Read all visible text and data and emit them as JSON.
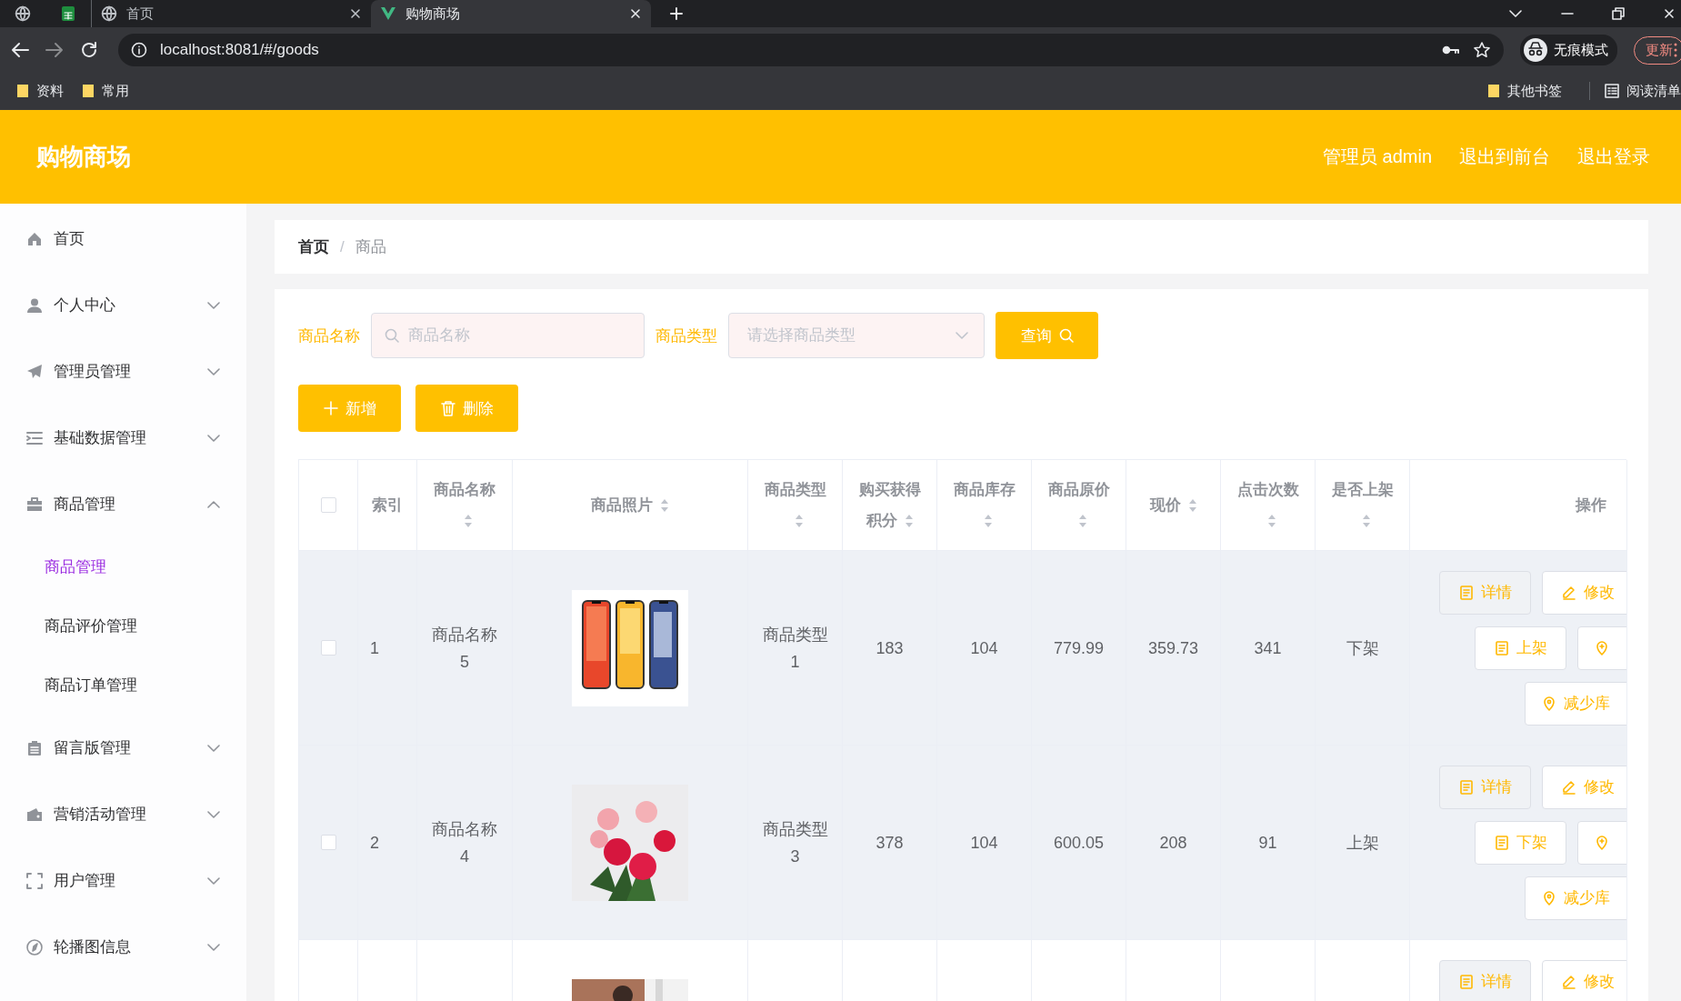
{
  "browser": {
    "tabs": [
      {
        "kind": "pinned-globe",
        "selected": false
      },
      {
        "kind": "pinned-sheet",
        "selected": false
      },
      {
        "kind": "page",
        "label": "首页",
        "selected": false
      },
      {
        "kind": "page",
        "label": "购物商场",
        "selected": true
      }
    ],
    "url": "localhost:8081/#/goods",
    "profile": "无痕模式",
    "update_button": "更新",
    "bookmarks": [
      {
        "label": "资料"
      },
      {
        "label": "常用"
      }
    ],
    "bookmarks_right": [
      {
        "kind": "folder",
        "label": "其他书签"
      },
      {
        "kind": "reading-list",
        "label": "阅读清单"
      }
    ]
  },
  "header": {
    "title": "购物商场",
    "links": [
      "管理员 admin",
      "退出到前台",
      "退出登录"
    ]
  },
  "sidebar": {
    "items": [
      {
        "label": "首页"
      },
      {
        "label": "个人中心",
        "expanded": false
      },
      {
        "label": "管理员管理",
        "expanded": false
      },
      {
        "label": "基础数据管理",
        "expanded": false
      },
      {
        "label": "商品管理",
        "expanded": true,
        "children": [
          {
            "label": "商品管理",
            "selected": true
          },
          {
            "label": "商品评价管理",
            "selected": false
          },
          {
            "label": "商品订单管理",
            "selected": false
          }
        ]
      },
      {
        "label": "留言版管理",
        "expanded": false
      },
      {
        "label": "营销活动管理",
        "expanded": false
      },
      {
        "label": "用户管理",
        "expanded": false
      },
      {
        "label": "轮播图信息",
        "expanded": false
      }
    ]
  },
  "breadcrumb": {
    "items": [
      "首页",
      "商品"
    ],
    "separator": "/"
  },
  "filters": [
    {
      "kind": "text",
      "label": "商品名称",
      "placeholder": "商品名称"
    },
    {
      "kind": "select",
      "label": "商品类型",
      "placeholder": "请选择商品类型"
    }
  ],
  "search_button": "查询",
  "actions": [
    {
      "kind": "add",
      "label": "新增"
    },
    {
      "kind": "delete",
      "label": "删除"
    }
  ],
  "table": {
    "select_all": {
      "checked": false
    },
    "columns": [
      {
        "kind": "check"
      },
      {
        "kind": "text",
        "label": "索引",
        "sortable": false
      },
      {
        "kind": "text",
        "label": "商品名称",
        "sortable": true
      },
      {
        "kind": "text",
        "label": "商品照片",
        "sortable": true
      },
      {
        "kind": "text",
        "label": "商品类型",
        "sortable": true
      },
      {
        "kind": "text",
        "label": "购买获得积分",
        "sortable": true
      },
      {
        "kind": "text",
        "label": "商品库存",
        "sortable": true
      },
      {
        "kind": "text",
        "label": "商品原价",
        "sortable": true
      },
      {
        "kind": "text",
        "label": "现价",
        "sortable": true
      },
      {
        "kind": "text",
        "label": "点击次数",
        "sortable": true
      },
      {
        "kind": "text",
        "label": "是否上架",
        "sortable": true
      },
      {
        "kind": "ops",
        "label": "操作",
        "sortable": false
      }
    ],
    "rows": [
      {
        "highlighted": true,
        "checked": false,
        "index": "1",
        "name": "商品名称5",
        "photo": {
          "kind": "picture"
        },
        "type": "商品类型1",
        "points": "183",
        "stock": "104",
        "original_price": "779.99",
        "price": "359.73",
        "clicks": "341",
        "status": "下架",
        "actions": [
          {
            "kind": "detail",
            "label": "详情"
          },
          {
            "kind": "edit",
            "label": "修改"
          },
          {
            "kind": "toggle",
            "label": "上架"
          },
          {
            "kind": "add-stock"
          },
          {
            "kind": "reduce-stock",
            "label": "减少库"
          }
        ]
      },
      {
        "highlighted": true,
        "checked": false,
        "index": "2",
        "name": "商品名称4",
        "photo": {
          "kind": "picture"
        },
        "type": "商品类型3",
        "points": "378",
        "stock": "104",
        "original_price": "600.05",
        "price": "208",
        "clicks": "91",
        "status": "上架",
        "actions": [
          {
            "kind": "detail",
            "label": "详情"
          },
          {
            "kind": "edit",
            "label": "修改"
          },
          {
            "kind": "toggle",
            "label": "下架"
          },
          {
            "kind": "add-stock"
          },
          {
            "kind": "reduce-stock",
            "label": "减少库"
          }
        ]
      },
      {
        "highlighted": false,
        "photo": {
          "kind": "picture"
        },
        "actions": [
          {
            "kind": "detail",
            "label": "详情"
          },
          {
            "kind": "edit",
            "label": "修改"
          }
        ]
      }
    ]
  }
}
